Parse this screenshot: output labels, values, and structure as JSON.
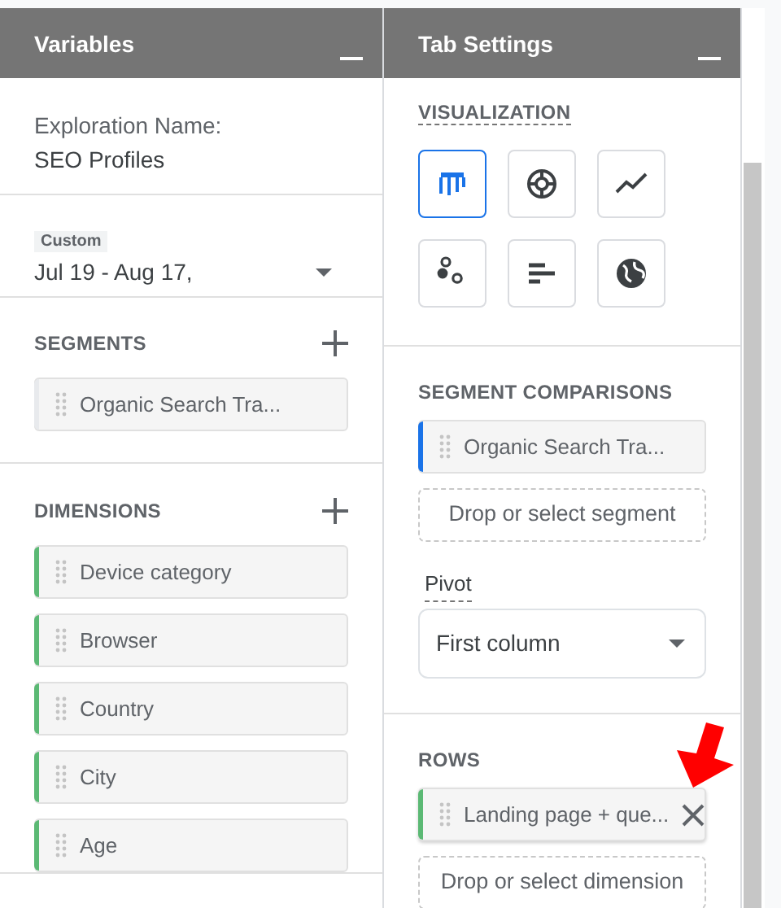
{
  "variables_panel": {
    "title": "Variables",
    "exploration_name_label": "Exploration Name:",
    "exploration_name": "SEO Profiles",
    "date_range": {
      "label": "Custom",
      "value": "Jul 19 - Aug 17,"
    },
    "segments": {
      "title": "SEGMENTS",
      "items": [
        {
          "label": "Organic Search Tra...",
          "color": "#e8eaed"
        }
      ]
    },
    "dimensions": {
      "title": "DIMENSIONS",
      "items": [
        {
          "label": "Device category",
          "color": "#5bb974"
        },
        {
          "label": "Browser",
          "color": "#5bb974"
        },
        {
          "label": "Country",
          "color": "#5bb974"
        },
        {
          "label": "City",
          "color": "#5bb974"
        },
        {
          "label": "Age",
          "color": "#5bb974"
        }
      ]
    }
  },
  "tab_settings_panel": {
    "title": "Tab Settings",
    "visualization": {
      "title": "VISUALIZATION",
      "options": [
        {
          "kind": "table",
          "selected": true
        },
        {
          "kind": "donut",
          "selected": false
        },
        {
          "kind": "line",
          "selected": false
        },
        {
          "kind": "scatter",
          "selected": false
        },
        {
          "kind": "bar",
          "selected": false
        },
        {
          "kind": "geo",
          "selected": false
        }
      ]
    },
    "segment_comparisons": {
      "title": "SEGMENT COMPARISONS",
      "items": [
        {
          "label": "Organic Search Tra...",
          "color": "#1a73e8"
        }
      ],
      "drop_target": "Drop or select segment"
    },
    "pivot": {
      "label": "Pivot",
      "value": "First column"
    },
    "rows": {
      "title": "ROWS",
      "items": [
        {
          "label": "Landing page + que...",
          "color": "#5bb974",
          "removable": true
        }
      ],
      "drop_target": "Drop or select dimension"
    }
  }
}
